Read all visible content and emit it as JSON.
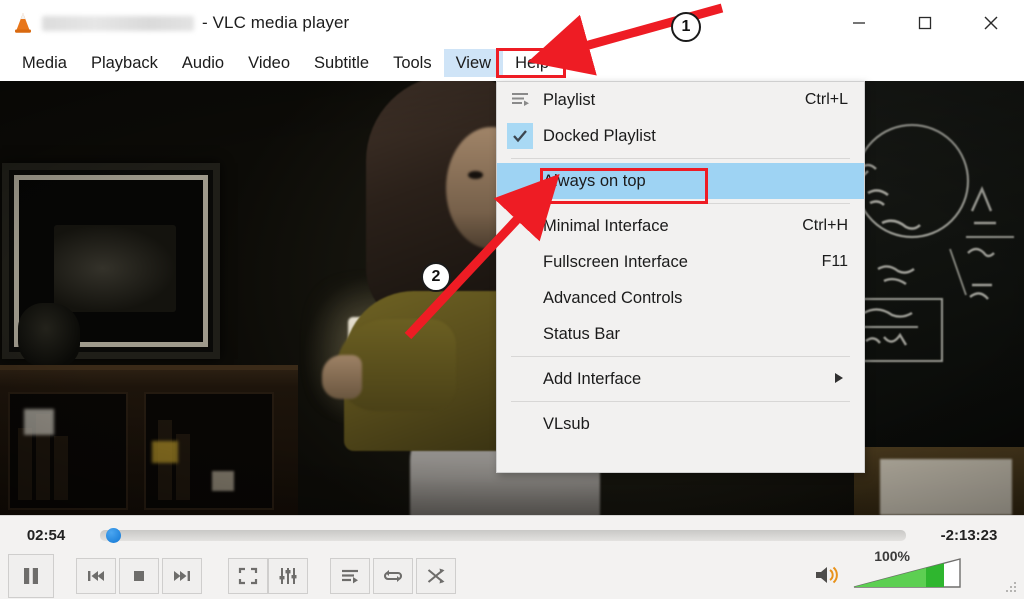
{
  "window": {
    "title_suffix": "- VLC media player",
    "app_name": "VLC media player",
    "icon": "vlc-cone-icon",
    "minimize_label": "Minimize",
    "maximize_label": "Maximize",
    "close_label": "Close"
  },
  "menubar": {
    "items": [
      {
        "label": "Media",
        "active": false
      },
      {
        "label": "Playback",
        "active": false
      },
      {
        "label": "Audio",
        "active": false
      },
      {
        "label": "Video",
        "active": false
      },
      {
        "label": "Subtitle",
        "active": false
      },
      {
        "label": "Tools",
        "active": false
      },
      {
        "label": "View",
        "active": true
      },
      {
        "label": "Help",
        "active": false
      }
    ]
  },
  "view_menu": {
    "items": [
      {
        "label": "Playlist",
        "accel": "Ctrl+L",
        "icon": "playlist-icon",
        "checked": false,
        "highlighted": false
      },
      {
        "label": "Docked Playlist",
        "accel": "",
        "icon": "check-icon",
        "checked": true,
        "highlighted": false
      },
      {
        "label": "Always on top",
        "accel": "",
        "icon": "",
        "checked": false,
        "highlighted": true
      },
      {
        "label": "Minimal Interface",
        "accel": "Ctrl+H",
        "icon": "",
        "checked": false,
        "highlighted": false
      },
      {
        "label": "Fullscreen Interface",
        "accel": "F11",
        "icon": "",
        "checked": false,
        "highlighted": false
      },
      {
        "label": "Advanced Controls",
        "accel": "",
        "icon": "",
        "checked": false,
        "highlighted": false
      },
      {
        "label": "Status Bar",
        "accel": "",
        "icon": "",
        "checked": false,
        "highlighted": false
      },
      {
        "label": "Add Interface",
        "accel": "",
        "icon": "",
        "submenu": true,
        "checked": false,
        "highlighted": false
      },
      {
        "label": "VLsub",
        "accel": "",
        "icon": "",
        "checked": false,
        "highlighted": false
      }
    ]
  },
  "player": {
    "time_elapsed": "02:54",
    "time_remaining": "-2:13:23",
    "seek_position_percent": 1,
    "volume_label": "100%",
    "volume_percent": 100,
    "state": "playing"
  },
  "controls": {
    "pause_label": "Pause",
    "previous_label": "Previous",
    "stop_label": "Stop",
    "next_label": "Next",
    "fullscreen_label": "Toggle fullscreen",
    "extended_label": "Show extended settings",
    "playlist_label": "Show playlist",
    "loop_label": "Loop",
    "random_label": "Random"
  },
  "annotations": {
    "markers": [
      {
        "number": "1",
        "points_to": "View menu"
      },
      {
        "number": "2",
        "points_to": "Always on top"
      }
    ],
    "highlight_color": "#ee1c24",
    "menu_highlight_color": "#9ed3f3"
  }
}
